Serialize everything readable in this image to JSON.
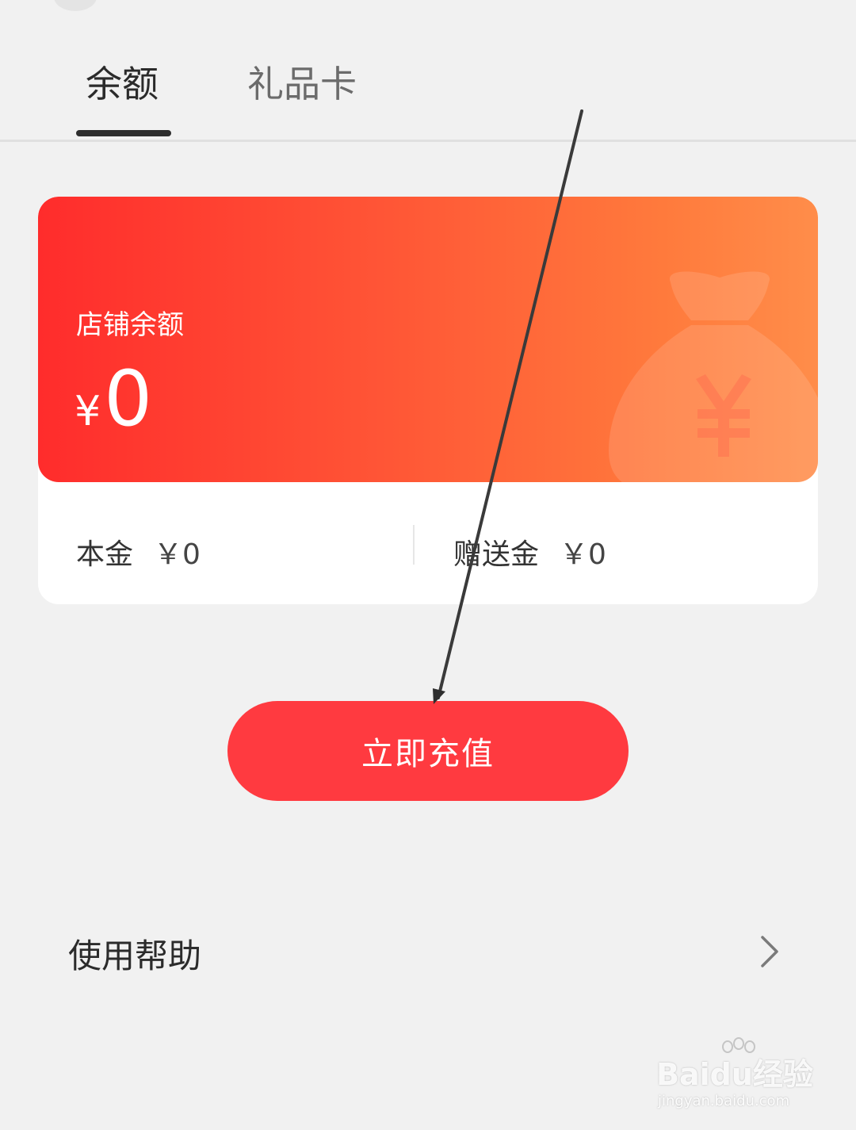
{
  "tabs": [
    {
      "label": "余额",
      "active": true
    },
    {
      "label": "礼品卡",
      "active": false
    }
  ],
  "balance_card": {
    "title": "店铺余额",
    "currency_symbol": "¥",
    "amount": "0",
    "gradient_colors": [
      "#ff2c2c",
      "#ff8d4a"
    ],
    "background_icon": "money-bag-icon",
    "principal": {
      "label": "本金",
      "value": "￥0"
    },
    "bonus": {
      "label": "赠送金",
      "value": "￥0"
    }
  },
  "actions": {
    "recharge_label": "立即充值",
    "accent_color": "#ff3a40"
  },
  "help": {
    "label": "使用帮助",
    "icon": "chevron-right-icon"
  },
  "watermark": {
    "brand": "Baidu经验",
    "url": "jingyan.baidu.com"
  }
}
